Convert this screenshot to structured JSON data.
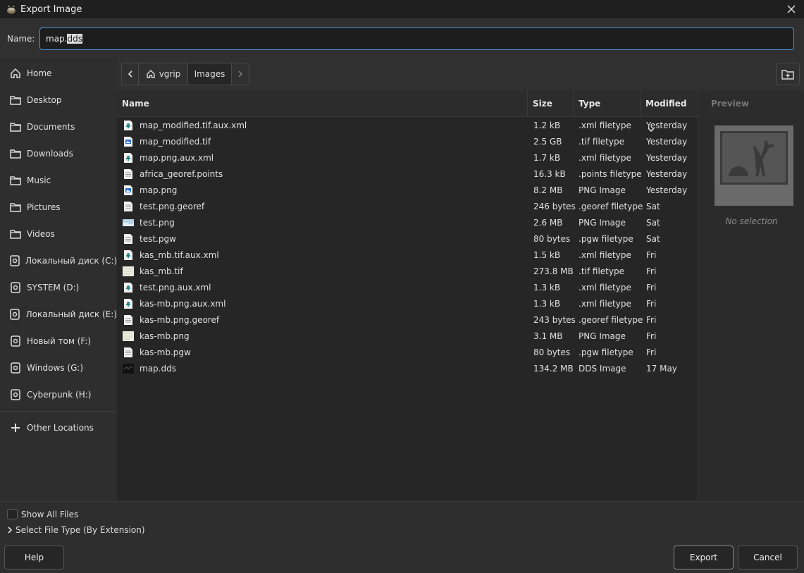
{
  "window": {
    "title": "Export Image"
  },
  "name_field": {
    "label": "Name:",
    "value_plain": "map.",
    "value_selected": "dds"
  },
  "sidebar": {
    "items": [
      {
        "label": "Home",
        "icon": "home-icon"
      },
      {
        "label": "Desktop",
        "icon": "folder-icon"
      },
      {
        "label": "Documents",
        "icon": "folder-icon"
      },
      {
        "label": "Downloads",
        "icon": "folder-icon"
      },
      {
        "label": "Music",
        "icon": "folder-icon"
      },
      {
        "label": "Pictures",
        "icon": "folder-icon"
      },
      {
        "label": "Videos",
        "icon": "folder-icon"
      },
      {
        "label": "Локальный диск (C:)",
        "icon": "drive-icon"
      },
      {
        "label": "SYSTEM (D:)",
        "icon": "drive-icon"
      },
      {
        "label": "Локальный диск (E:)",
        "icon": "drive-icon"
      },
      {
        "label": "Новый том (F:)",
        "icon": "drive-icon"
      },
      {
        "label": "Windows (G:)",
        "icon": "drive-icon"
      },
      {
        "label": "Cyberpunk (H:)",
        "icon": "drive-icon"
      }
    ],
    "other_locations": "Other Locations"
  },
  "pathbar": {
    "crumbs": [
      "vgrip",
      "Images"
    ]
  },
  "columns": {
    "name": "Name",
    "size": "Size",
    "type": "Type",
    "modified": "Modified"
  },
  "preview": {
    "header": "Preview",
    "empty_text": "No selection"
  },
  "files": [
    {
      "name": "map_modified.tif.aux.xml",
      "size": "1.2 kB",
      "type": ".xml filetype",
      "modified": "Yesterday",
      "icon": "xml-file-icon"
    },
    {
      "name": "map_modified.tif",
      "size": "2.5 GB",
      "type": ".tif filetype",
      "modified": "Yesterday",
      "icon": "image-file-icon"
    },
    {
      "name": "map.png.aux.xml",
      "size": "1.7 kB",
      "type": ".xml filetype",
      "modified": "Yesterday",
      "icon": "xml-file-icon"
    },
    {
      "name": "africa_georef.points",
      "size": "16.3 kB",
      "type": ".points filetype",
      "modified": "Yesterday",
      "icon": "text-file-icon"
    },
    {
      "name": "map.png",
      "size": "8.2 MB",
      "type": "PNG Image",
      "modified": "Yesterday",
      "icon": "image-file-icon"
    },
    {
      "name": "test.png.georef",
      "size": "246 bytes",
      "type": ".georef filetype",
      "modified": "Sat",
      "icon": "text-file-icon"
    },
    {
      "name": "test.png",
      "size": "2.6 MB",
      "type": "PNG Image",
      "modified": "Sat",
      "icon": "thumbnail-icon"
    },
    {
      "name": "test.pgw",
      "size": "80 bytes",
      "type": ".pgw filetype",
      "modified": "Sat",
      "icon": "text-file-icon"
    },
    {
      "name": "kas_mb.tif.aux.xml",
      "size": "1.5 kB",
      "type": ".xml filetype",
      "modified": "Fri",
      "icon": "xml-file-icon"
    },
    {
      "name": "kas_mb.tif",
      "size": "273.8 MB",
      "type": ".tif filetype",
      "modified": "Fri",
      "icon": "thumbnail-light-icon"
    },
    {
      "name": "test.png.aux.xml",
      "size": "1.3 kB",
      "type": ".xml filetype",
      "modified": "Fri",
      "icon": "xml-file-icon"
    },
    {
      "name": "kas-mb.png.aux.xml",
      "size": "1.3 kB",
      "type": ".xml filetype",
      "modified": "Fri",
      "icon": "xml-file-icon"
    },
    {
      "name": "kas-mb.png.georef",
      "size": "243 bytes",
      "type": ".georef filetype",
      "modified": "Fri",
      "icon": "text-file-icon"
    },
    {
      "name": "kas-mb.png",
      "size": "3.1 MB",
      "type": "PNG Image",
      "modified": "Fri",
      "icon": "thumbnail-light-icon"
    },
    {
      "name": "kas-mb.pgw",
      "size": "80 bytes",
      "type": ".pgw filetype",
      "modified": "Fri",
      "icon": "text-file-icon"
    },
    {
      "name": "map.dds",
      "size": "134.2 MB",
      "type": "DDS Image",
      "modified": "17 May",
      "icon": "thumbnail-dark-icon"
    }
  ],
  "options": {
    "show_all_files": "Show All Files",
    "select_file_type": "Select File Type (By Extension)"
  },
  "buttons": {
    "help": "Help",
    "export": "Export",
    "cancel": "Cancel"
  }
}
